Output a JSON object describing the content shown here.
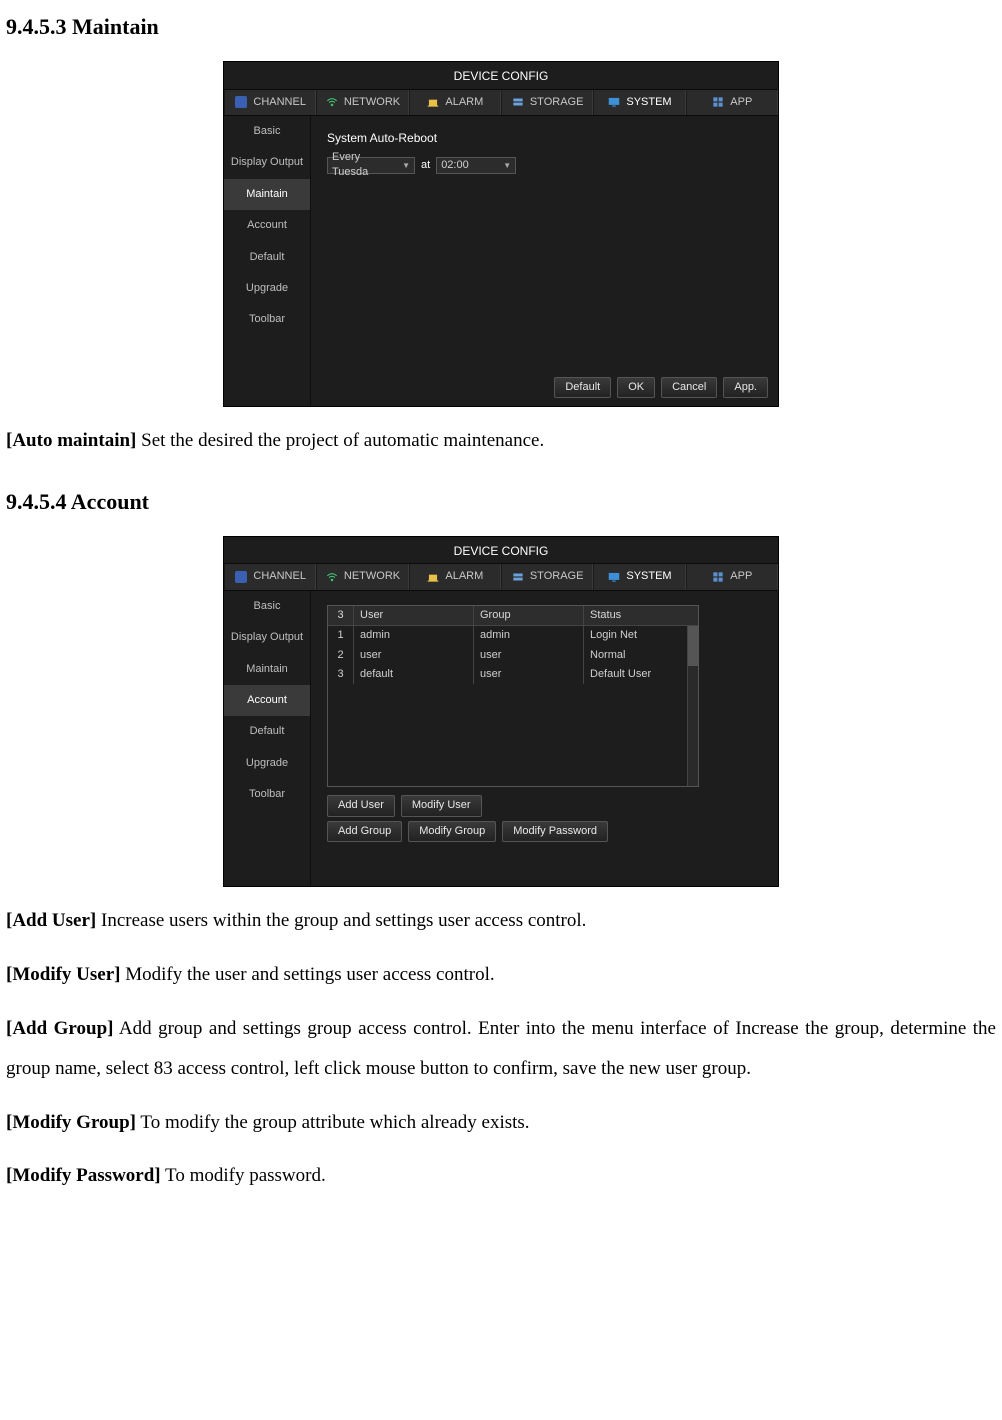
{
  "doc": {
    "heading1": "9.4.5.3 Maintain",
    "maintain_desc_term": "[Auto maintain]",
    "maintain_desc_text": " Set the desired the project of automatic maintenance.",
    "heading2": "9.4.5.4 Account",
    "account": {
      "adduser_term": "[Add User]",
      "adduser_text": " Increase users within the group and settings user access control.",
      "modifyuser_term": "[Modify User]",
      "modifyuser_text": " Modify the user and settings user access control.",
      "addgroup_term": "[Add Group]",
      "addgroup_text": " Add group and settings group access control. Enter into the menu interface of Increase the group, determine the group name, select 83 access control, left click mouse button to confirm, save the new user group.",
      "modifygroup_term": "[Modify Group]",
      "modifygroup_text": " To modify the group attribute which already exists.",
      "modifypwd_term": "[Modify Password]",
      "modifypwd_text": " To modify password."
    }
  },
  "panel": {
    "title": "DEVICE CONFIG",
    "tabs": {
      "channel": "CHANNEL",
      "network": "NETWORK",
      "alarm": "ALARM",
      "storage": "STORAGE",
      "system": "SYSTEM",
      "app": "APP"
    },
    "sidebar": {
      "basic": "Basic",
      "display": "Display Output",
      "maintain": "Maintain",
      "account": "Account",
      "default": "Default",
      "upgrade": "Upgrade",
      "toolbar": "Toolbar"
    },
    "maintain": {
      "heading": "System Auto-Reboot",
      "day": "Every Tuesda",
      "at": "at",
      "time": "02:00"
    },
    "footer": {
      "default": "Default",
      "ok": "OK",
      "cancel": "Cancel",
      "app": "App."
    },
    "account_panel": {
      "head_count": "3",
      "head_user": "User",
      "head_group": "Group",
      "head_status": "Status",
      "rows": [
        {
          "n": "1",
          "user": "admin",
          "group": "admin",
          "status": "Login Net"
        },
        {
          "n": "2",
          "user": "user",
          "group": "user",
          "status": "Normal"
        },
        {
          "n": "3",
          "user": "default",
          "group": "user",
          "status": "Default User"
        }
      ],
      "btn_add_user": "Add User",
      "btn_modify_user": "Modify User",
      "btn_add_group": "Add Group",
      "btn_modify_group": "Modify Group",
      "btn_modify_password": "Modify Password"
    }
  }
}
